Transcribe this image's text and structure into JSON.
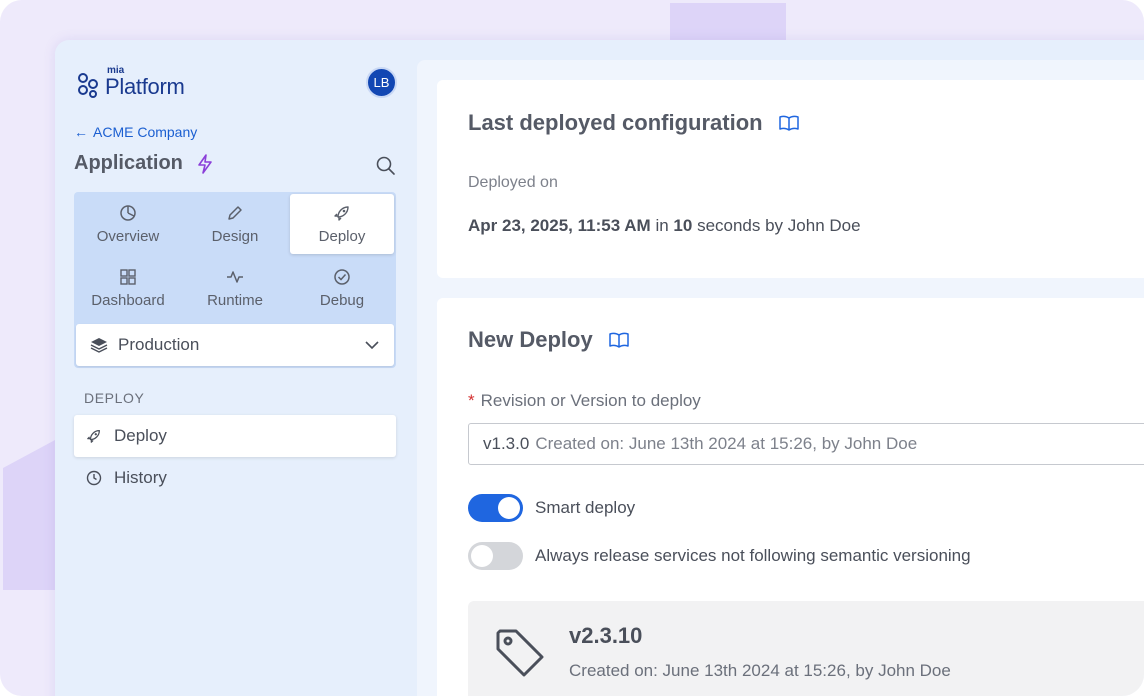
{
  "brand": {
    "small": "mia",
    "big": "Platform"
  },
  "user": {
    "initials": "LB"
  },
  "back_link": "ACME Company",
  "app_title": "Application",
  "nav": [
    {
      "label": "Overview",
      "icon": "pie-chart-icon"
    },
    {
      "label": "Design",
      "icon": "pencil-icon"
    },
    {
      "label": "Deploy",
      "icon": "rocket-icon",
      "active": true
    },
    {
      "label": "Dashboard",
      "icon": "grid-icon"
    },
    {
      "label": "Runtime",
      "icon": "activity-icon"
    },
    {
      "label": "Debug",
      "icon": "check-circle-icon"
    }
  ],
  "environment": {
    "selected": "Production",
    "icon": "layers-icon"
  },
  "sidebar_section": "DEPLOY",
  "sidebar_items": [
    {
      "label": "Deploy",
      "icon": "rocket-icon",
      "active": true
    },
    {
      "label": "History",
      "icon": "clock-icon"
    }
  ],
  "last_deployed": {
    "title": "Last deployed configuration",
    "label": "Deployed on",
    "date": "Apr 23, 2025, 11:53 AM",
    "in_word": "in",
    "duration": "10",
    "suffix": "seconds by John Doe"
  },
  "new_deploy": {
    "title": "New Deploy",
    "field_label": "Revision or Version to deploy",
    "selected_version": "v1.3.0",
    "selected_meta": "Created on: June 13th 2024 at 15:26, by John Doe",
    "smart_deploy": {
      "label": "Smart deploy",
      "on": true
    },
    "always_release": {
      "label": "Always release services not following semantic versioning",
      "on": false
    },
    "version_card": {
      "version": "v2.3.10",
      "meta": "Created on: June 13th 2024 at 15:26, by John Doe"
    }
  },
  "colors": {
    "accent": "#1f66e0",
    "brand": "#1a3a8f",
    "sidebar_bg": "#e6effc",
    "lightning": "#8b3fd9"
  }
}
